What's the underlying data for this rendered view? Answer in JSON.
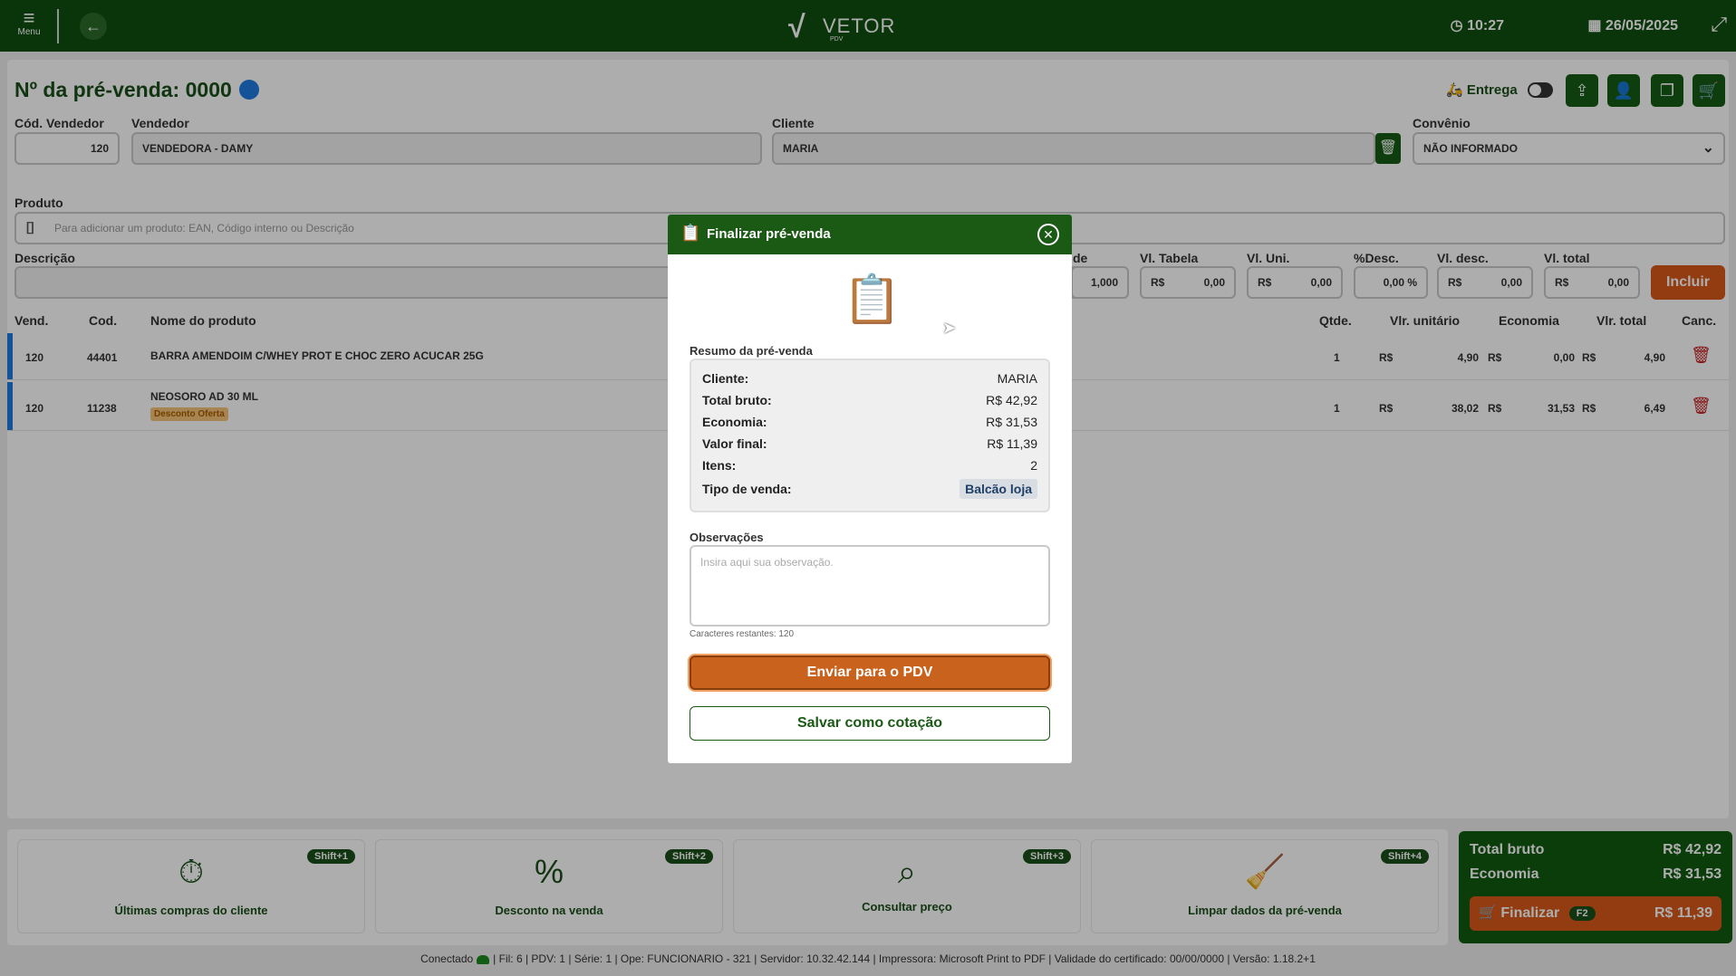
{
  "topbar": {
    "menu_label": "Menu",
    "logo_text": "VETOR",
    "logo_sub": "PDV",
    "time": "10:27",
    "date": "26/05/2025"
  },
  "header": {
    "title": "Nº da pré-venda: 0000",
    "entrega_label": "Entrega"
  },
  "form": {
    "cod_vendedor_label": "Cód. Vendedor",
    "cod_vendedor": "120",
    "vendedor_label": "Vendedor",
    "vendedor": "VENDEDORA - DAMY",
    "cliente_label": "Cliente",
    "cliente": "MARIA",
    "convenio_label": "Convênio",
    "convenio": "NÃO INFORMADO",
    "produto_label": "Produto",
    "produto_placeholder": "Para adicionar um produto: EAN, Código interno ou Descrição",
    "descricao_label": "Descrição",
    "qtde_label_partial": "de",
    "qtde_value": "1,000",
    "vl_tabela_label": "Vl. Tabela",
    "vl_tabela": "0,00",
    "vl_uni_label": "Vl. Uni.",
    "vl_uni": "0,00",
    "pct_desc_label": "%Desc.",
    "pct_desc": "0,00 %",
    "vl_desc_label": "Vl. desc.",
    "vl_desc": "0,00",
    "vl_total_label": "Vl. total",
    "vl_total": "0,00",
    "currency": "R$",
    "incluir_label": "Incluir"
  },
  "table": {
    "headers": {
      "vend": "Vend.",
      "cod": "Cod.",
      "nome": "Nome do produto",
      "qtde": "Qtde.",
      "vlr_unit": "Vlr. unitário",
      "economia": "Economia",
      "vlr_total": "Vlr. total",
      "canc": "Canc."
    },
    "rows": [
      {
        "vend": "120",
        "cod": "44401",
        "nome": "BARRA AMENDOIM C/WHEY PROT E CHOC ZERO ACUCAR 25G",
        "tag": "",
        "qtde": "1",
        "currency": "R$",
        "vlr_unit": "4,90",
        "economia": "0,00",
        "vlr_total": "4,90"
      },
      {
        "vend": "120",
        "cod": "11238",
        "nome": "NEOSORO AD 30 ML",
        "tag": "Desconto Oferta",
        "qtde": "1",
        "currency": "R$",
        "vlr_unit": "38,02",
        "economia": "31,53",
        "vlr_total": "6,49"
      }
    ]
  },
  "footer_cards": [
    {
      "label": "Últimas compras do cliente",
      "shortcut": "Shift+1"
    },
    {
      "label": "Desconto na venda",
      "shortcut": "Shift+2"
    },
    {
      "label": "Consultar preço",
      "shortcut": "Shift+3"
    },
    {
      "label": "Limpar dados da pré-venda",
      "shortcut": "Shift+4"
    }
  ],
  "totals": {
    "total_bruto_label": "Total bruto",
    "total_bruto": "R$ 42,92",
    "economia_label": "Economia",
    "economia": "R$ 31,53",
    "finalizar_label": "Finalizar",
    "finalizar_key": "F2",
    "finalizar_value": "R$ 11,39"
  },
  "statusbar": {
    "conectado": "Conectado",
    "info": "| Fil: 6 | PDV: 1 | Série: 1 | Ope: FUNCIONARIO - 321 | Servidor: 10.32.42.144 | Impressora: Microsoft Print to PDF | Validade do certificado: 00/00/0000 | Versão: 1.18.2+1"
  },
  "modal": {
    "title": "Finalizar pré-venda",
    "resumo_label": "Resumo da pré-venda",
    "rows": {
      "cliente_label": "Cliente:",
      "cliente": "MARIA",
      "total_bruto_label": "Total bruto:",
      "total_bruto": "R$ 42,92",
      "economia_label": "Economia:",
      "economia": "R$ 31,53",
      "valor_final_label": "Valor final:",
      "valor_final": "R$ 11,39",
      "itens_label": "Itens:",
      "itens": "2",
      "tipo_venda_label": "Tipo de venda:",
      "tipo_venda": "Balcão loja"
    },
    "obs_label": "Observações",
    "obs_placeholder": "Insira aqui sua observação.",
    "counter": "Caracteres restantes: 120",
    "primary_button": "Enviar para o PDV",
    "secondary_button": "Salvar como cotação"
  },
  "colors": {
    "brand_green": "#0f4f0f",
    "accent_orange": "#d9591a",
    "blue": "#1e7be0",
    "danger": "#c21d1d"
  }
}
